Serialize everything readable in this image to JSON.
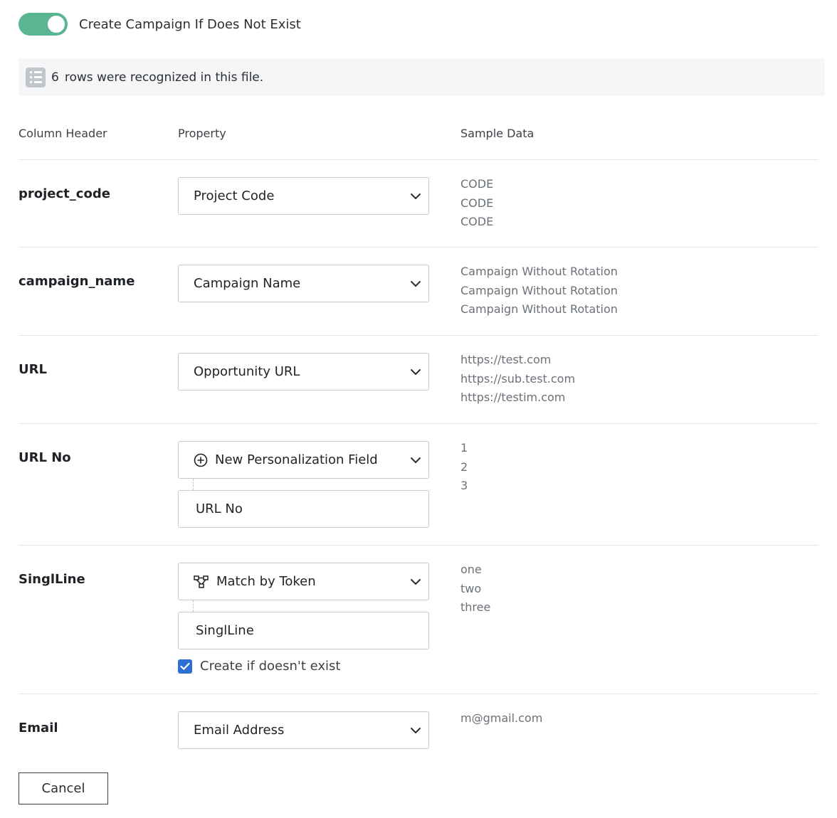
{
  "toggle": {
    "label": "Create Campaign If Does Not Exist",
    "checked": true,
    "on_color": "#5cb592"
  },
  "info": {
    "icon": "list-icon",
    "count": "6",
    "text": "rows were recognized in this file."
  },
  "columns": {
    "header": "Column Header",
    "property": "Property",
    "sample": "Sample Data"
  },
  "rows": [
    {
      "label": "project_code",
      "property": "Project Code",
      "samples": [
        "CODE",
        "CODE",
        "CODE"
      ]
    },
    {
      "label": "campaign_name",
      "property": "Campaign Name",
      "samples": [
        "Campaign Without Rotation",
        "Campaign Without Rotation",
        "Campaign Without Rotation"
      ]
    },
    {
      "label": "URL",
      "property": "Opportunity URL",
      "samples": [
        "https://test.com",
        "https://sub.test.com",
        "https://testim.com"
      ]
    },
    {
      "label": "URL No",
      "property": "New Personalization Field",
      "property_icon": "plus-circle-icon",
      "field_value": "URL No",
      "samples": [
        "1",
        "2",
        "3"
      ]
    },
    {
      "label": "SinglLine",
      "property": "Match by Token",
      "property_icon": "token-network-icon",
      "field_value": "SinglLine",
      "checkbox_label": "Create if doesn't exist",
      "checkbox_checked": true,
      "samples": [
        "one",
        "two",
        "three"
      ]
    },
    {
      "label": "Email",
      "property": "Email Address",
      "samples": [
        "m@gmail.com"
      ]
    }
  ],
  "footer": {
    "cancel_label": "Cancel"
  },
  "colors": {
    "accent_blue": "#2f6fd4",
    "border": "#c6cacf",
    "muted_text": "#6b7178"
  }
}
